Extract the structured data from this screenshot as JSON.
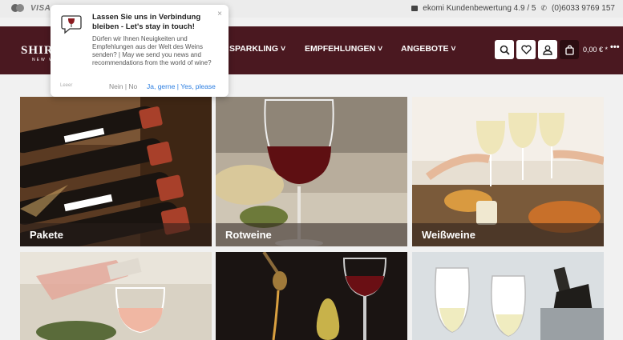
{
  "topbar": {
    "payment_icons": [
      "mastercard-icon"
    ],
    "visa_label": "VISA",
    "rating_label": "ekomi Kundenbewertung 4.9 / 5",
    "phone": "(0)6033 9769 157"
  },
  "header": {
    "logo_text": "SHIR",
    "logo_sub": "NEW W",
    "nav": [
      {
        "label": "SPARKLING"
      },
      {
        "label": "EMPFEHLUNGEN"
      },
      {
        "label": "ANGEBOTE"
      }
    ],
    "cart_total": "0,00 € *",
    "more": "•••"
  },
  "tiles": [
    {
      "label": "Pakete"
    },
    {
      "label": "Rotweine"
    },
    {
      "label": "Weißweine"
    },
    {
      "label": ""
    },
    {
      "label": ""
    },
    {
      "label": ""
    }
  ],
  "popup": {
    "title": "Lassen Sie uns in Verbindung bleiben - Let's stay in touch!",
    "body": "Dürfen wir Ihnen Neuigkeiten und Empfehlungen aus der Welt des Weins senden? | May we send you news and recommendations from the world of wine?",
    "close": "×",
    "brand": "Leeer",
    "no_label": "Nein | No",
    "yes_label": "Ja, gerne | Yes, please"
  },
  "colors": {
    "header_bg": "#4a1820",
    "accent_link": "#2a7de1"
  }
}
